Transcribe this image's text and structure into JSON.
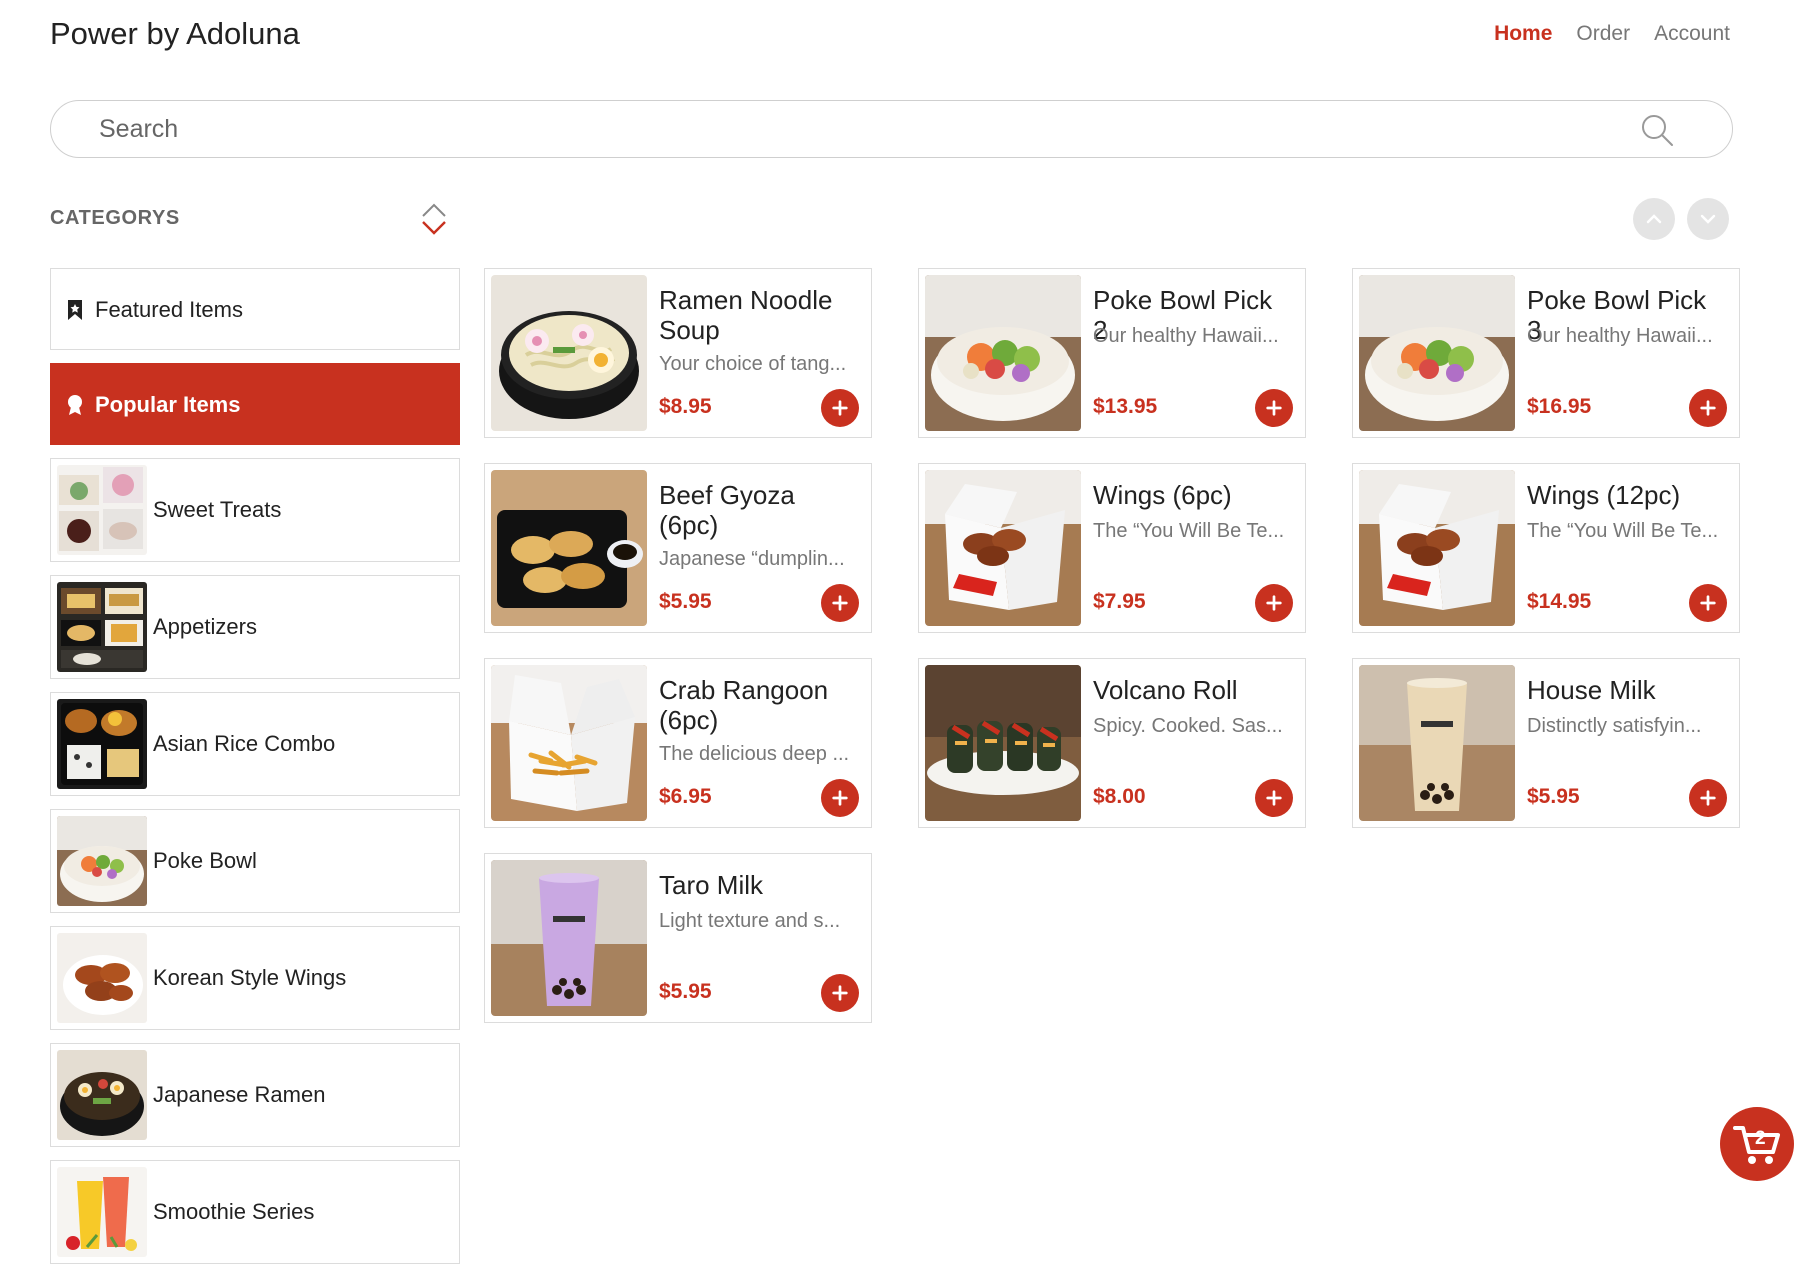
{
  "header": {
    "brand": "Power by Adoluna",
    "nav": [
      {
        "label": "Home",
        "active": true
      },
      {
        "label": "Order",
        "active": false
      },
      {
        "label": "Account",
        "active": false
      }
    ]
  },
  "search": {
    "placeholder": "Search",
    "value": ""
  },
  "categories": {
    "title": "CATEGORYS",
    "items": [
      {
        "label": "Featured Items",
        "icon": "bookmark-icon"
      },
      {
        "label": "Popular Items",
        "icon": "popular-icon",
        "active": true
      },
      {
        "label": "Sweet Treats",
        "thumb": "sweet-treats-thumbnail"
      },
      {
        "label": "Appetizers",
        "thumb": "appetizers-thumbnail"
      },
      {
        "label": "Asian Rice Combo",
        "thumb": "asian-rice-combo-thumbnail"
      },
      {
        "label": "Poke Bowl",
        "thumb": "poke-bowl-thumbnail"
      },
      {
        "label": "Korean Style Wings",
        "thumb": "korean-wings-thumbnail"
      },
      {
        "label": "Japanese Ramen",
        "thumb": "japanese-ramen-thumbnail"
      },
      {
        "label": "Smoothie Series",
        "thumb": "smoothie-thumbnail"
      }
    ]
  },
  "products": [
    {
      "name": "Ramen Noodle Soup",
      "desc": "Your choice of tang...",
      "price": "$8.95",
      "image": "ramen-photo"
    },
    {
      "name": "Poke Bowl Pick 2",
      "desc": "Our healthy Hawaii...",
      "price": "$13.95",
      "image": "poke-bowl-photo"
    },
    {
      "name": "Poke Bowl Pick 3",
      "desc": "Our healthy Hawaii...",
      "price": "$16.95",
      "image": "poke-bowl-photo"
    },
    {
      "name": "Beef Gyoza (6pc)",
      "desc": "Japanese “dumplin...",
      "price": "$5.95",
      "image": "gyoza-photo"
    },
    {
      "name": "Wings (6pc)",
      "desc": "The “You Will Be Te...",
      "price": "$7.95",
      "image": "wings-box-photo"
    },
    {
      "name": "Wings (12pc)",
      "desc": "The “You Will Be Te...",
      "price": "$14.95",
      "image": "wings-box-photo"
    },
    {
      "name": "Crab Rangoon (6pc)",
      "desc": "The delicious deep ...",
      "price": "$6.95",
      "image": "crab-rangoon-photo"
    },
    {
      "name": "Volcano Roll",
      "desc": "Spicy. Cooked. Sas...",
      "price": "$8.00",
      "image": "volcano-roll-photo"
    },
    {
      "name": "House Milk",
      "desc": "Distinctly satisfyin...",
      "price": "$5.95",
      "image": "house-milk-photo"
    },
    {
      "name": "Taro Milk",
      "desc": "Light texture and s...",
      "price": "$5.95",
      "image": "taro-milk-photo"
    }
  ],
  "cart": {
    "count": "2",
    "icon": "cart-icon"
  },
  "colors": {
    "accent": "#c8311f",
    "text": "#222222",
    "muted": "#777777",
    "border": "#dcdcdc"
  }
}
